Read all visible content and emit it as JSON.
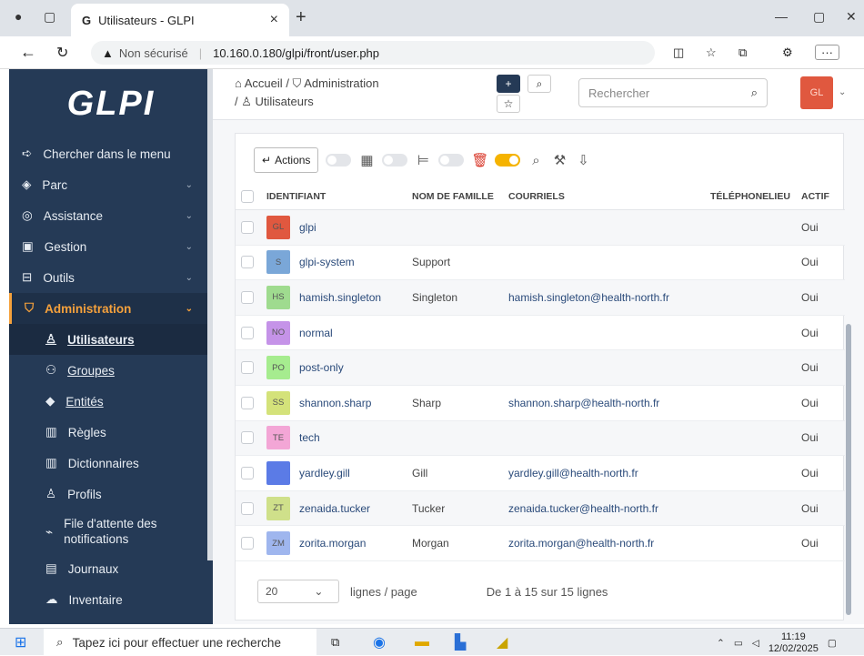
{
  "browser": {
    "tab_title": "Utilisateurs - GLPI",
    "url_security": "Non sécurisé",
    "url": "10.160.0.180/glpi/front/user.php"
  },
  "sidebar": {
    "logo": "GLPI",
    "items": [
      {
        "label": "Chercher dans le menu",
        "icon": "arrow-right-icon"
      },
      {
        "label": "Parc",
        "icon": "box-icon"
      },
      {
        "label": "Assistance",
        "icon": "headset-icon"
      },
      {
        "label": "Gestion",
        "icon": "wallet-icon"
      },
      {
        "label": "Outils",
        "icon": "briefcase-icon"
      },
      {
        "label": "Administration",
        "icon": "shield-icon"
      }
    ],
    "subitems": [
      {
        "label": "Utilisateurs",
        "icon": "user-icon"
      },
      {
        "label": "Groupes",
        "icon": "users-icon"
      },
      {
        "label": "Entités",
        "icon": "layers-icon"
      },
      {
        "label": "Règles",
        "icon": "book-icon"
      },
      {
        "label": "Dictionnaires",
        "icon": "book-open-icon"
      },
      {
        "label": "Profils",
        "icon": "user-check-icon"
      },
      {
        "label": "File d'attente des notifications",
        "icon": "bell-icon"
      },
      {
        "label": "Journaux",
        "icon": "log-icon"
      },
      {
        "label": "Inventaire",
        "icon": "cloud-icon"
      }
    ]
  },
  "header": {
    "crumb_home": "Accueil",
    "crumb_admin": "Administration",
    "crumb_users": "Utilisateurs",
    "search_placeholder": "Rechercher",
    "avatar_initials": "GL"
  },
  "toolbar": {
    "actions_label": "Actions"
  },
  "columns": [
    "IDENTIFIANT",
    "NOM DE FAMILLE",
    "COURRIELS",
    "TÉLÉPHONE",
    "LIEU",
    "ACTIF"
  ],
  "rows": [
    {
      "initials": "GL",
      "color": "#e0583f",
      "login": "glpi",
      "nom": "",
      "mail": "",
      "actif": "Oui"
    },
    {
      "initials": "S",
      "color": "#7aa7d8",
      "login": "glpi-system",
      "nom": "Support",
      "mail": "",
      "actif": "Oui"
    },
    {
      "initials": "HS",
      "color": "#9fdb8f",
      "login": "hamish.singleton",
      "nom": "Singleton",
      "mail": "hamish.singleton@health-north.fr",
      "actif": "Oui"
    },
    {
      "initials": "NO",
      "color": "#c593e8",
      "login": "normal",
      "nom": "",
      "mail": "",
      "actif": "Oui"
    },
    {
      "initials": "PO",
      "color": "#a6ec8f",
      "login": "post-only",
      "nom": "",
      "mail": "",
      "actif": "Oui"
    },
    {
      "initials": "SS",
      "color": "#d4e27a",
      "login": "shannon.sharp",
      "nom": "Sharp",
      "mail": "shannon.sharp@health-north.fr",
      "actif": "Oui"
    },
    {
      "initials": "TE",
      "color": "#f3a6d6",
      "login": "tech",
      "nom": "",
      "mail": "",
      "actif": "Oui"
    },
    {
      "initials": "",
      "color": "#5b7be6",
      "login": "yardley.gill",
      "nom": "Gill",
      "mail": "yardley.gill@health-north.fr",
      "actif": "Oui"
    },
    {
      "initials": "ZT",
      "color": "#cfe08a",
      "login": "zenaida.tucker",
      "nom": "Tucker",
      "mail": "zenaida.tucker@health-north.fr",
      "actif": "Oui"
    },
    {
      "initials": "ZM",
      "color": "#9fb6ee",
      "login": "zorita.morgan",
      "nom": "Morgan",
      "mail": "zorita.morgan@health-north.fr",
      "actif": "Oui"
    }
  ],
  "pager": {
    "per_page": "20",
    "per_page_label": "lignes / page",
    "summary": "De 1 à 15 sur 15 lignes"
  },
  "taskbar": {
    "search_placeholder": "Tapez ici pour effectuer une recherche",
    "time": "11:19",
    "date": "12/02/2025"
  }
}
